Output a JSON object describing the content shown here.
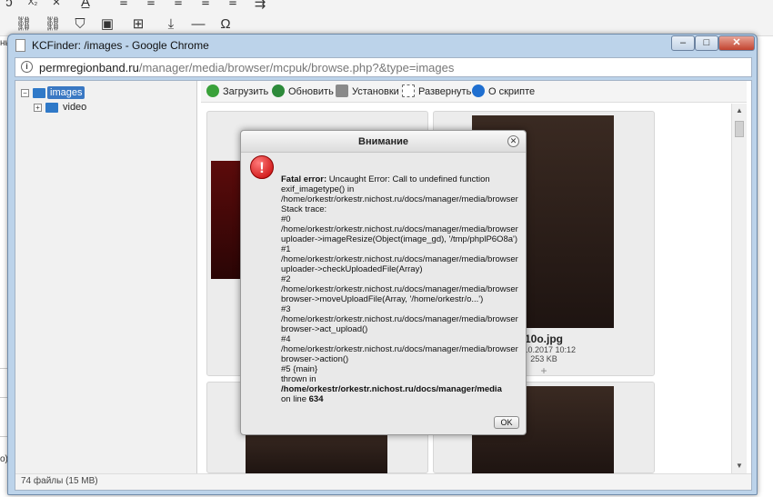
{
  "background": {
    "toolbar_row1_glyphs": [
      "ↄ",
      "X₂",
      "×",
      "A̲",
      "≡",
      "≡",
      "≡",
      "≡",
      "≡",
      "⇶"
    ],
    "toolbar_row2_glyphs": [
      "⛓",
      "⛓",
      "⛉",
      "▣",
      "⊞",
      "⤓",
      "—",
      "Ω"
    ],
    "left_fragment": "нь",
    "left_fragment_2": "о)"
  },
  "window": {
    "title": "KCFinder: /images - Google Chrome",
    "min_label": "–",
    "max_label": "□",
    "close_label": "✕"
  },
  "address": {
    "info_glyph": "i",
    "host": "permregionband.ru",
    "path": "/manager/media/browser/mcpuk/browse.php?&type=images"
  },
  "tree": {
    "items": [
      {
        "toggle": "−",
        "label": "images",
        "selected": true
      },
      {
        "toggle": "+",
        "label": "video",
        "selected": false
      }
    ]
  },
  "toolbar": {
    "upload": "Загрузить",
    "refresh": "Обновить",
    "settings": "Установки",
    "expand": "Развернуть",
    "about": "О скрипте"
  },
  "files": {
    "card2_name": "10o.jpg",
    "card2_date": "16.10.2017 10:12",
    "card2_size": "253 KB",
    "plus": "+"
  },
  "status": {
    "text": "74 файлы (15 MB)"
  },
  "dialog": {
    "title": "Внимание",
    "close_glyph": "✕",
    "icon_glyph": "!",
    "lines": [
      {
        "bold": "Fatal error: ",
        "text": "Uncaught Error: Call to undefined function"
      },
      {
        "bold": "",
        "text": "exif_imagetype() in"
      },
      {
        "bold": "",
        "text": "/home/orkestr/orkestr.nichost.ru/docs/manager/media/browser/"
      },
      {
        "bold": "",
        "text": "Stack trace:"
      },
      {
        "bold": "",
        "text": "#0"
      },
      {
        "bold": "",
        "text": "/home/orkestr/orkestr.nichost.ru/docs/manager/media/browser/"
      },
      {
        "bold": "",
        "text": "uploader->imageResize(Object(image_gd), '/tmp/phplP6O8a')"
      },
      {
        "bold": "",
        "text": "#1"
      },
      {
        "bold": "",
        "text": "/home/orkestr/orkestr.nichost.ru/docs/manager/media/browser/"
      },
      {
        "bold": "",
        "text": "uploader->checkUploadedFile(Array)"
      },
      {
        "bold": "",
        "text": "#2"
      },
      {
        "bold": "",
        "text": "/home/orkestr/orkestr.nichost.ru/docs/manager/media/browser/"
      },
      {
        "bold": "",
        "text": "browser->moveUploadFile(Array, '/home/orkestr/o...')"
      },
      {
        "bold": "",
        "text": "#3"
      },
      {
        "bold": "",
        "text": "/home/orkestr/orkestr.nichost.ru/docs/manager/media/browser/"
      },
      {
        "bold": "",
        "text": "browser->act_upload()"
      },
      {
        "bold": "",
        "text": "#4"
      },
      {
        "bold": "",
        "text": "/home/orkestr/orkestr.nichost.ru/docs/manager/media/browser/"
      },
      {
        "bold": "",
        "text": "browser->action()"
      },
      {
        "bold": "",
        "text": "#5 {main}"
      },
      {
        "bold": "",
        "text": "thrown in"
      },
      {
        "bold": "/home/orkestr/orkestr.nichost.ru/docs/manager/media",
        "text": ""
      },
      {
        "bold": "",
        "text": "on line ",
        "tail_bold": "634"
      }
    ],
    "ok_label": "OK"
  },
  "colors": {
    "chrome_frame": "#bcd3ea",
    "close_red": "#c2432f",
    "selection_blue": "#3a78c3",
    "error_red": "#c40000"
  }
}
